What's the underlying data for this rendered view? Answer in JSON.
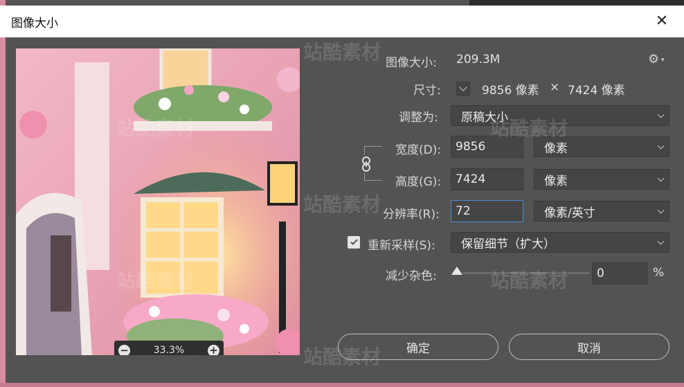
{
  "window": {
    "title": "图像大小",
    "close_glyph": "✕"
  },
  "summary": {
    "label": "图像大小:",
    "value": "209.3M"
  },
  "dimensions": {
    "label": "尺寸:",
    "width": "9856 像素",
    "times": "×",
    "height": "7424 像素"
  },
  "fit_to": {
    "label": "调整为:",
    "value": "原稿大小"
  },
  "width": {
    "label": "宽度(D):",
    "value": "9856",
    "unit": "像素"
  },
  "height": {
    "label": "高度(G):",
    "value": "7424",
    "unit": "像素"
  },
  "resolution": {
    "label": "分辨率(R):",
    "value": "72",
    "unit": "像素/英寸"
  },
  "resample": {
    "label": "重新采样(S):",
    "checked": true,
    "value": "保留细节（扩大）"
  },
  "noise": {
    "label": "减少杂色:",
    "value": "0",
    "unit": "%",
    "level": 0
  },
  "preview": {
    "zoom": "33.3%",
    "zoom_out": "−",
    "zoom_in": "+"
  },
  "buttons": {
    "ok": "确定",
    "cancel": "取消"
  },
  "icons": {
    "gear": "gear-icon",
    "link": "link-icon",
    "close": "close-icon"
  },
  "watermark_text": "站酷素材",
  "colors": {
    "dialog_bg": "#535353",
    "input_bg": "#454545",
    "focus": "#4a8ed6"
  }
}
